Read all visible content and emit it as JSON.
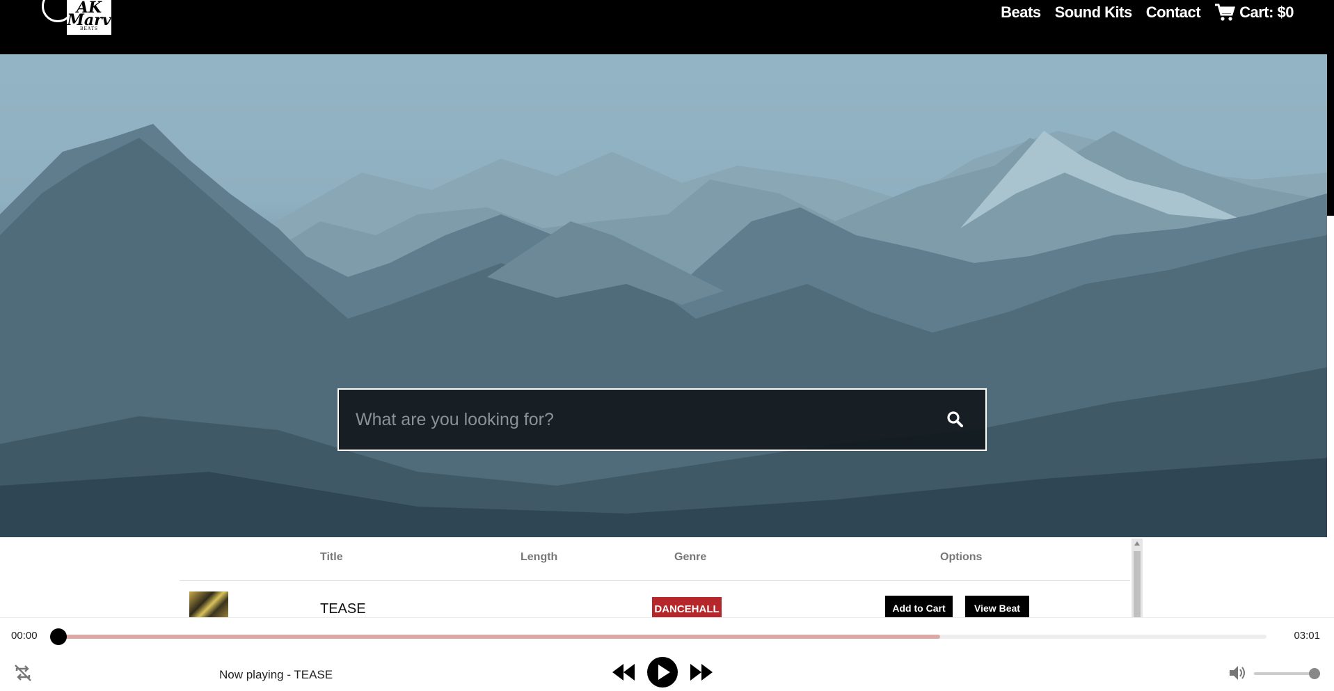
{
  "brand": {
    "logo_text": "AK Marv",
    "logo_sub": "BEATS"
  },
  "nav": {
    "items": [
      "Beats",
      "Sound Kits",
      "Contact"
    ],
    "cart_label": "Cart: $0",
    "cart_icon": "shopping-cart-icon"
  },
  "search": {
    "placeholder": "What are you looking for?",
    "icon": "search-icon"
  },
  "table": {
    "headers": {
      "title": "Title",
      "length": "Length",
      "genre": "Genre",
      "options": "Options"
    },
    "rows": [
      {
        "title": "TEASE",
        "length": "",
        "genre": "DANCEHALL",
        "genre_color": "#b5272a",
        "add_label": "Add to Cart",
        "view_label": "View Beat"
      }
    ]
  },
  "player": {
    "current_time": "00:00",
    "total_time": "03:01",
    "buffered_fraction": 0.73,
    "now_playing": "Now playing - TEASE",
    "volume_fraction": 1.0,
    "icons": [
      "repeat-icon",
      "rewind-icon",
      "play-icon",
      "fast-forward-icon",
      "volume-icon"
    ]
  },
  "colors": {
    "header_bg": "#000000",
    "accent": "#dcaaa6",
    "genre_badge": "#b5272a"
  }
}
